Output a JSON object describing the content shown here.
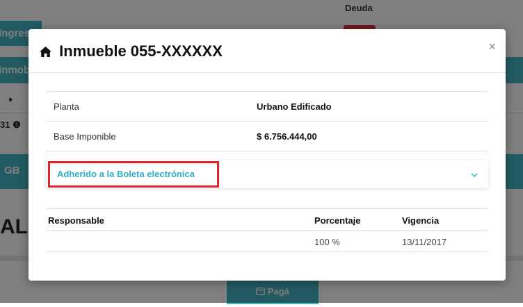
{
  "background": {
    "bar1_text": "Ingres",
    "bar2_text": "Inmob",
    "sort_glyph": "♦",
    "number_fragment": "31",
    "info_glyph": "❶",
    "deuda_label": "Deuda",
    "group_text": "GB",
    "big_text": "AL",
    "pay_button": "Pagá"
  },
  "modal": {
    "title": "Inmueble 055-XXXXXX",
    "title_icon": "home-icon",
    "close": "×",
    "properties": [
      {
        "label": "Planta",
        "value": "Urbano Edificado"
      },
      {
        "label": "Base Imponible",
        "value": "$ 6.756.444,00"
      }
    ],
    "accordion": {
      "label": "Adherido a la Boleta electrónica",
      "icon": "chevron-down-icon"
    },
    "responsables": {
      "headers": [
        "Responsable",
        "Porcentaje",
        "Vigencia"
      ],
      "rows": [
        [
          "",
          "100 %",
          "13/11/2017"
        ]
      ]
    }
  },
  "colors": {
    "accent": "#45b5c4",
    "highlight": "#e8202a",
    "link": "#2ab0c6"
  }
}
